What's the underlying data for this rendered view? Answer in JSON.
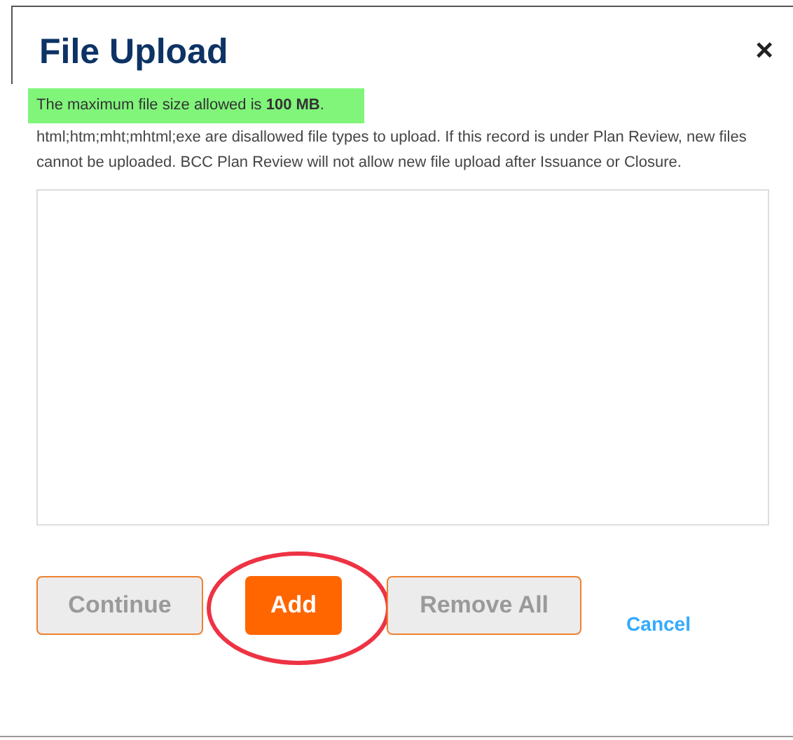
{
  "dialog": {
    "title": "File Upload",
    "close": "×"
  },
  "notice": {
    "text": "The maximum file size allowed is **100 MB**.",
    "highlighted": true
  },
  "description": "html;htm;mht;mhtml;exe are disallowed file types to upload. If this record is under Plan Review, new files cannot be uploaded. BCC Plan Review will not allow new file upload after Issuance or Closure.",
  "buttons": [
    {
      "label": "Continue",
      "disabled": true,
      "circled": false
    },
    {
      "label": "Add",
      "disabled": false,
      "circled": true
    },
    {
      "label": "Remove All",
      "disabled": true,
      "circled": false
    }
  ],
  "cancel": "Cancel"
}
